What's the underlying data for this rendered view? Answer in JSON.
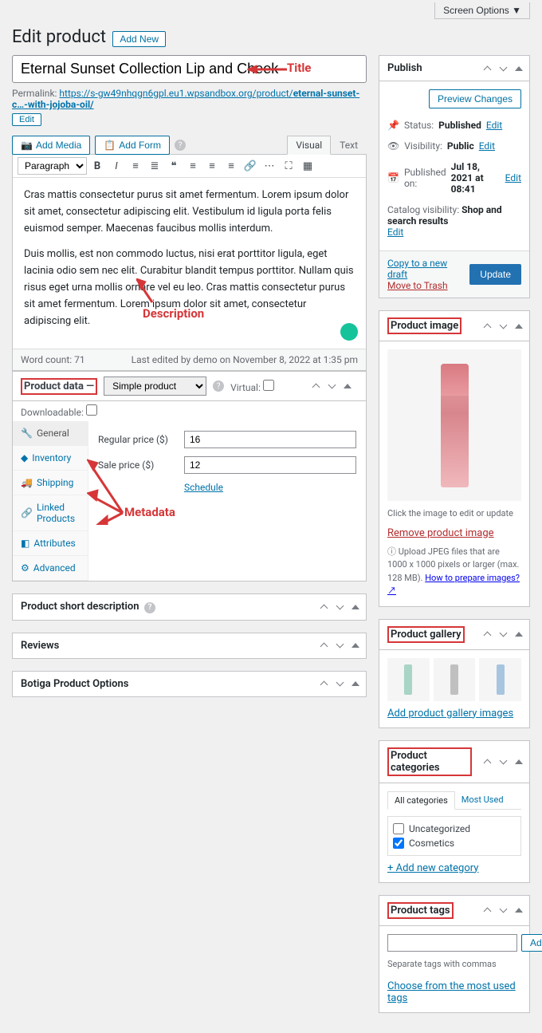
{
  "screenOptions": "Screen Options",
  "pageTitle": "Edit product",
  "addNew": "Add New",
  "title": "Eternal Sunset Collection Lip and Cheek",
  "permalink": {
    "label": "Permalink:",
    "base": "https://s-gw49nhqgn6gpl.eu1.wpsandbox.org/product/",
    "slug": "eternal-sunset-c…-with-jojoba-oil/",
    "edit": "Edit"
  },
  "editor": {
    "addMedia": "Add Media",
    "addForm": "Add Form",
    "tabVisual": "Visual",
    "tabText": "Text",
    "format": "Paragraph",
    "content_p1": "Cras mattis consectetur purus sit amet fermentum. Lorem ipsum dolor sit amet, consectetur adipiscing elit. Vestibulum id ligula porta felis euismod semper. Maecenas faucibus mollis interdum.",
    "content_p2": "Duis mollis, est non commodo luctus, nisi erat porttitor ligula, eget lacinia odio sem nec elit. Curabitur blandit tempus porttitor. Nullam quis risus eget urna mollis ornare vel eu leo. Cras mattis consectetur purus sit amet fermentum. Lorem ipsum dolor sit amet, consectetur adipiscing elit.",
    "wordCountLabel": "Word count: 71",
    "lastEdited": "Last edited by demo on November 8, 2022 at 1:35 pm"
  },
  "annotations": {
    "title": "Title",
    "description": "Description",
    "metadata": "Metadata"
  },
  "productData": {
    "heading": "Product data —",
    "typeSelected": "Simple product",
    "virtualLabel": "Virtual:",
    "downloadableLabel": "Downloadable:",
    "tabs": {
      "general": "General",
      "inventory": "Inventory",
      "shipping": "Shipping",
      "linked": "Linked Products",
      "attributes": "Attributes",
      "advanced": "Advanced"
    },
    "regularPriceLabel": "Regular price ($)",
    "regularPrice": "16",
    "salePriceLabel": "Sale price ($)",
    "salePrice": "12",
    "schedule": "Schedule"
  },
  "boxes": {
    "shortDesc": "Product short description",
    "reviews": "Reviews",
    "botiga": "Botiga Product Options"
  },
  "publish": {
    "heading": "Publish",
    "preview": "Preview Changes",
    "statusLabel": "Status:",
    "status": "Published",
    "visibilityLabel": "Visibility:",
    "visibility": "Public",
    "publishedLabel": "Published on:",
    "published": "Jul 18, 2021 at 08:41",
    "catalogVisLabel": "Catalog visibility:",
    "catalogVis": "Shop and search results",
    "edit": "Edit",
    "copyDraft": "Copy to a new draft",
    "trash": "Move to Trash",
    "update": "Update"
  },
  "productImage": {
    "heading": "Product image",
    "clickText": "Click the image to edit or update",
    "remove": "Remove product image",
    "uploadHelp": "Upload JPEG files that are 1000 x 1000 pixels or larger (max. 128 MB).",
    "howTo": "How to prepare images?"
  },
  "gallery": {
    "heading": "Product gallery",
    "addLink": "Add product gallery images"
  },
  "categories": {
    "heading": "Product categories",
    "tabAll": "All categories",
    "tabMostUsed": "Most Used",
    "items": [
      "Uncategorized",
      "Cosmetics"
    ],
    "addNew": "+ Add new category"
  },
  "tags": {
    "heading": "Product tags",
    "add": "Add",
    "separate": "Separate tags with commas",
    "choose": "Choose from the most used tags"
  }
}
